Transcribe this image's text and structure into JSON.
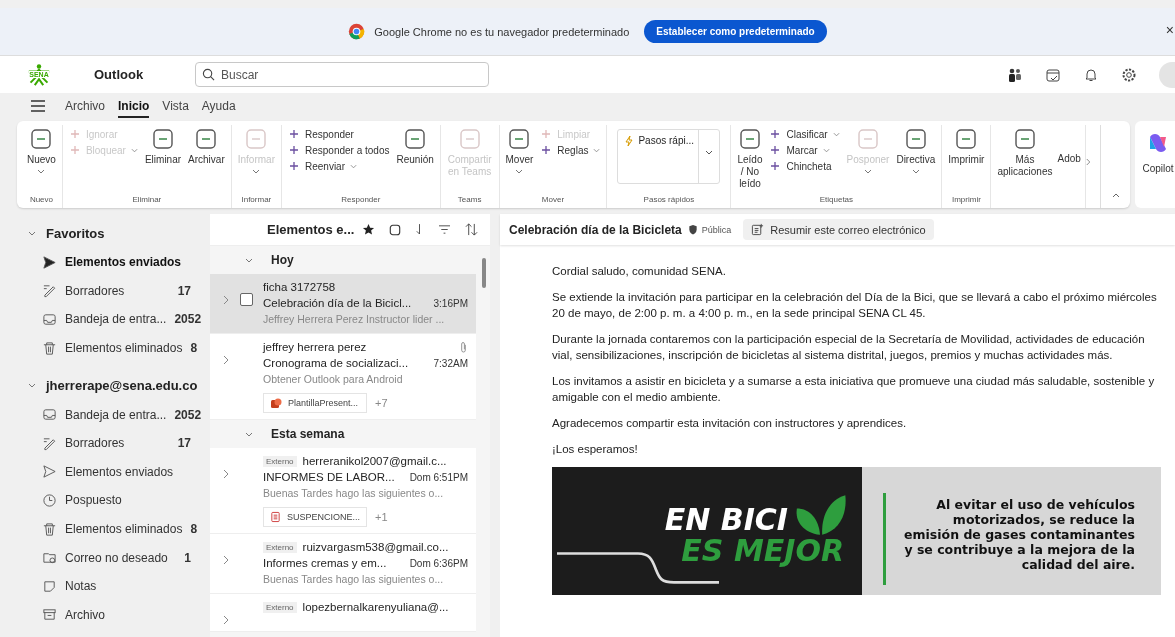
{
  "browser_banner": {
    "message": "Google Chrome no es tu navegador predeterminado",
    "button": "Establecer como predeterminado",
    "close": "×"
  },
  "header": {
    "logo_text": "SENA",
    "app": "Outlook",
    "search_placeholder": "Buscar"
  },
  "menu_tabs": [
    {
      "label": "Archivo",
      "selected": false
    },
    {
      "label": "Inicio",
      "selected": true
    },
    {
      "label": "Vista",
      "selected": false
    },
    {
      "label": "Ayuda",
      "selected": false
    }
  ],
  "ribbon": {
    "groups": [
      {
        "label": "Nuevo",
        "columns": [
          {
            "kind": "large",
            "label": "Nuevo",
            "caret": true
          }
        ]
      },
      {
        "label": "Eliminar",
        "columns": [
          {
            "kind": "stack",
            "items": [
              {
                "label": "Ignorar",
                "disabled": true
              },
              {
                "label": "Bloquear",
                "disabled": true,
                "caret": true
              }
            ]
          },
          {
            "kind": "large",
            "label": "Eliminar"
          },
          {
            "kind": "large",
            "label": "Archivar"
          }
        ]
      },
      {
        "label": "Informar",
        "columns": [
          {
            "kind": "large",
            "label": "Informar",
            "disabled": true,
            "caret": true
          }
        ]
      },
      {
        "label": "Responder",
        "columns": [
          {
            "kind": "stack",
            "items": [
              {
                "label": "Responder"
              },
              {
                "label": "Responder a todos"
              },
              {
                "label": "Reenviar",
                "caret": true
              }
            ]
          },
          {
            "kind": "large",
            "label": "Reunión"
          }
        ]
      },
      {
        "label": "Teams",
        "columns": [
          {
            "kind": "large",
            "label": "Compartir en Teams",
            "disabled": true
          }
        ]
      },
      {
        "label": "Mover",
        "columns": [
          {
            "kind": "large",
            "label": "Mover",
            "caret": true
          },
          {
            "kind": "stack",
            "items": [
              {
                "label": "Limpiar",
                "disabled": true
              },
              {
                "label": "Reglas",
                "caret": true
              }
            ]
          }
        ]
      },
      {
        "label": "Pasos rápidos",
        "columns": [
          {
            "kind": "dropdown",
            "label": "Pasos rápi...",
            "caret": true
          }
        ]
      },
      {
        "label": "Etiquetas",
        "columns": [
          {
            "kind": "large",
            "label": "Leído / No leído"
          },
          {
            "kind": "stack",
            "items": [
              {
                "label": "Clasificar",
                "caret": true
              },
              {
                "label": "Marcar",
                "caret": true
              },
              {
                "label": "Chincheta"
              }
            ]
          },
          {
            "kind": "large",
            "label": "Posponer",
            "disabled": true,
            "caret": true
          },
          {
            "kind": "large",
            "label": "Directiva",
            "caret": true
          }
        ]
      },
      {
        "label": "Imprimir",
        "columns": [
          {
            "kind": "large",
            "label": "Imprimir"
          }
        ]
      },
      {
        "columns": [
          {
            "kind": "large",
            "label": "Más aplicaciones"
          },
          {
            "kind": "cut",
            "label": "Adob"
          }
        ]
      }
    ],
    "copilot": "Copilot"
  },
  "navigation": [
    {
      "title": "Favoritos",
      "expanded": true,
      "items": [
        {
          "label": "Elementos enviados",
          "kind": "sent",
          "selected": true
        },
        {
          "label": "Borradores",
          "kind": "drafts",
          "count": "17",
          "selected": false
        },
        {
          "label": "Bandeja de entra...",
          "kind": "inbox",
          "count": "2052",
          "selected": false
        },
        {
          "label": "Elementos eliminados",
          "kind": "deleted",
          "count": "8",
          "selected": false
        }
      ]
    },
    {
      "title": "jherrerape@sena.edu.co",
      "expanded": true,
      "items": [
        {
          "label": "Bandeja de entra...",
          "kind": "inbox",
          "count": "2052",
          "selected": false
        },
        {
          "label": "Borradores",
          "kind": "drafts",
          "count": "17",
          "selected": false
        },
        {
          "label": "Elementos enviados",
          "kind": "sent",
          "selected": false
        },
        {
          "label": "Pospuesto",
          "kind": "snoozed",
          "selected": false
        },
        {
          "label": "Elementos eliminados",
          "kind": "deleted",
          "count": "8",
          "selected": false
        },
        {
          "label": "Correo no deseado",
          "kind": "junk",
          "count": "1",
          "selected": false
        },
        {
          "label": "Notas",
          "kind": "notes",
          "selected": false
        },
        {
          "label": "Archivo",
          "kind": "archive",
          "selected": false
        }
      ]
    }
  ],
  "message_list": {
    "title": "Elementos e...",
    "groups": [
      {
        "label": "Hoy",
        "expanded": true,
        "messages": [
          {
            "sender": "ficha 3172758",
            "subject": "Celebración día de la Bicicl...",
            "time": "3:16PM",
            "preview": "Jeffrey Herrera Perez Instructor lider ...",
            "selected": true
          },
          {
            "sender": "jeffrey herrera perez",
            "subject": "Cronograma de socializaci...",
            "time": "7:32AM",
            "preview": "Obtener Outlook para Android",
            "selected": false,
            "attachment_icon": true,
            "attachment": {
              "kind": "presentation",
              "name": "PlantillaPresent...",
              "more": "+7"
            }
          }
        ]
      },
      {
        "label": "Esta semana",
        "expanded": true,
        "messages": [
          {
            "tag": "Externo",
            "sender": "herreranikol2007@gmail.c...",
            "subject": "INFORMES DE LABOR...",
            "time": "Dom 6:51PM",
            "preview": "Buenas Tardes hago las siguientes o...",
            "selected": false,
            "attachment": {
              "kind": "pdf",
              "name": "SUSPENCIONE...",
              "more": "+1"
            }
          },
          {
            "tag": "Externo",
            "sender": "ruizvargasm538@gmail.co...",
            "subject": "Informes cremas y em...",
            "time": "Dom 6:36PM",
            "preview": "Buenas Tardes hago las siguientes o...",
            "selected": false
          },
          {
            "tag": "Externo",
            "sender": "lopezbernalkarenyuliana@...",
            "selected": false
          }
        ]
      }
    ]
  },
  "reading_pane": {
    "subject": "Celebración día de la Bicicleta",
    "label": "Pública",
    "summarize": "Resumir este correo electrónico",
    "paragraphs": [
      "Cordial saludo, comunidad SENA.",
      "Se extiende la invitación para participar en la celebración del Día de la Bici, que se llevará a cabo el próximo miércoles 20 de mayo, de 2:00 p. m. a 4:00 p. m., en la sede principal SENA CL 45.",
      "Durante la jornada contaremos con la participación especial de la Secretaría de Movilidad, actividades de educación vial, sensibilizaciones, inscripción de bicicletas al sistema distrital, juegos, premios y muchas actividades más.",
      "Los invitamos a asistir en bicicleta y a sumarse a esta iniciativa que promueve una ciudad más saludable, sostenible y amigable con el medio ambiente.",
      "Agradecemos compartir esta invitación con instructores y aprendices.",
      "¡Los esperamos!"
    ],
    "poster": {
      "headline_1": "EN BICI",
      "headline_2": "ES MEJOR",
      "text": "Al evitar el uso de vehículos motorizados, se reduce la emisión de gases contaminantes y se contribuye a la mejora de la calidad del aire."
    }
  }
}
